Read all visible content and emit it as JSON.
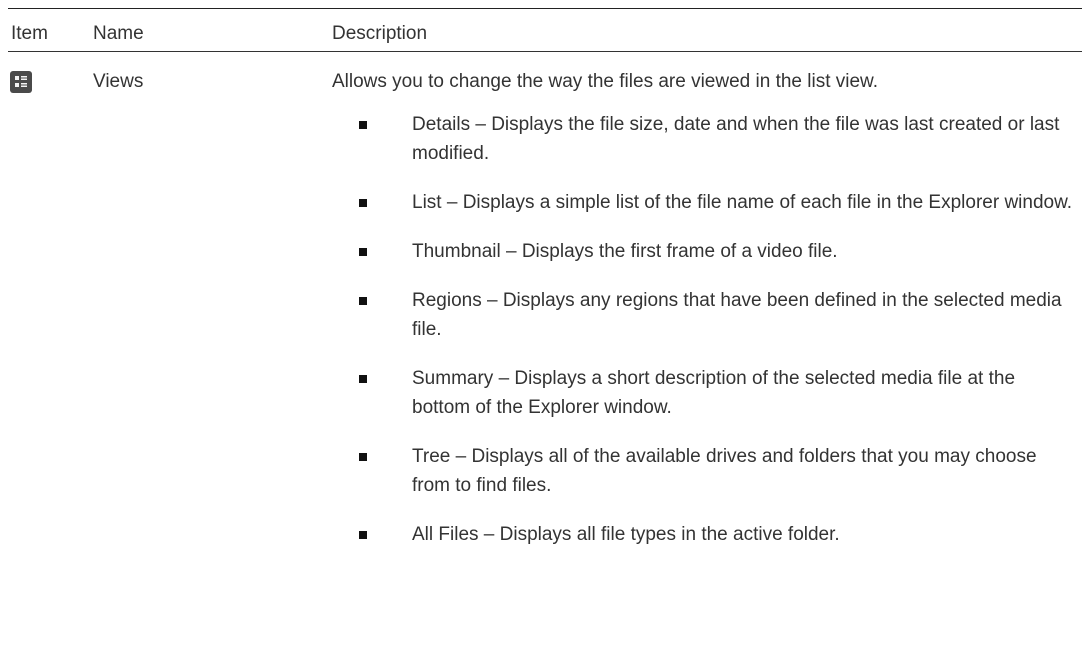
{
  "table": {
    "headers": {
      "item": "Item",
      "name": "Name",
      "description": "Description"
    },
    "rows": [
      {
        "icon": "views-icon",
        "name": "Views",
        "description": "Allows you to change the way the files are viewed in the list view.",
        "bullets": [
          "Details – Displays the file size, date and when the file was last created or last modified.",
          "List – Displays a simple list of the file name of each file in the Explorer window.",
          "Thumbnail – Displays the first frame of a video file.",
          "Regions – Displays any regions that have been defined in the selected media file.",
          "Summary – Displays a short description of the selected media file at the bottom of the Explorer window.",
          "Tree – Displays all of the available drives and folders that you may choose from to find files.",
          "All Files – Displays all file types in the active folder."
        ]
      }
    ]
  }
}
